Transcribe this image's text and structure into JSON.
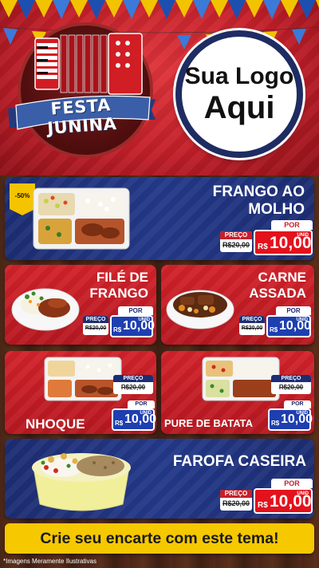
{
  "header": {
    "title": "FESTA JUNINA",
    "logo_line1": "Sua Logo",
    "logo_line2": "Aqui"
  },
  "products": [
    {
      "name_l1": "FRANGO AO",
      "name_l2": "MOLHO",
      "discount": "-50%",
      "por": "POR",
      "old_label": "PREÇO",
      "old_price": "R$20,00",
      "currency": "R$",
      "price": "10,00",
      "unit": "UNID"
    },
    {
      "name_l1": "FILÉ DE",
      "name_l2": "FRANGO",
      "por": "POR",
      "old_label": "PREÇO",
      "old_price": "R$20,00",
      "currency": "R$",
      "price": "10,00",
      "unit": "UNID"
    },
    {
      "name_l1": "CARNE",
      "name_l2": "ASSADA",
      "por": "POR",
      "old_label": "PREÇO",
      "old_price": "R$20,00",
      "currency": "R$",
      "price": "10,00",
      "unit": "UNID"
    },
    {
      "name_l1": "NHOQUE",
      "por": "POR",
      "old_label": "PREÇO",
      "old_price": "R$20,00",
      "currency": "R$",
      "price": "10,00",
      "unit": "UNID"
    },
    {
      "name_l1": "PURE DE BATATA",
      "por": "POR",
      "old_label": "PREÇO",
      "old_price": "R$20,00",
      "currency": "R$",
      "price": "10,00",
      "unit": "UNID"
    },
    {
      "name_l1": "FAROFA CASEIRA",
      "por": "POR",
      "old_label": "PREÇO",
      "old_price": "R$20,00",
      "currency": "R$",
      "price": "10,00",
      "unit": "UNID"
    }
  ],
  "cta": "Crie seu encarte com este tema!",
  "footnote": "*Imagens Meramente Ilustrativas",
  "colors": {
    "red": "#c4202a",
    "blue": "#1d2d73",
    "yellow": "#f5c800"
  }
}
